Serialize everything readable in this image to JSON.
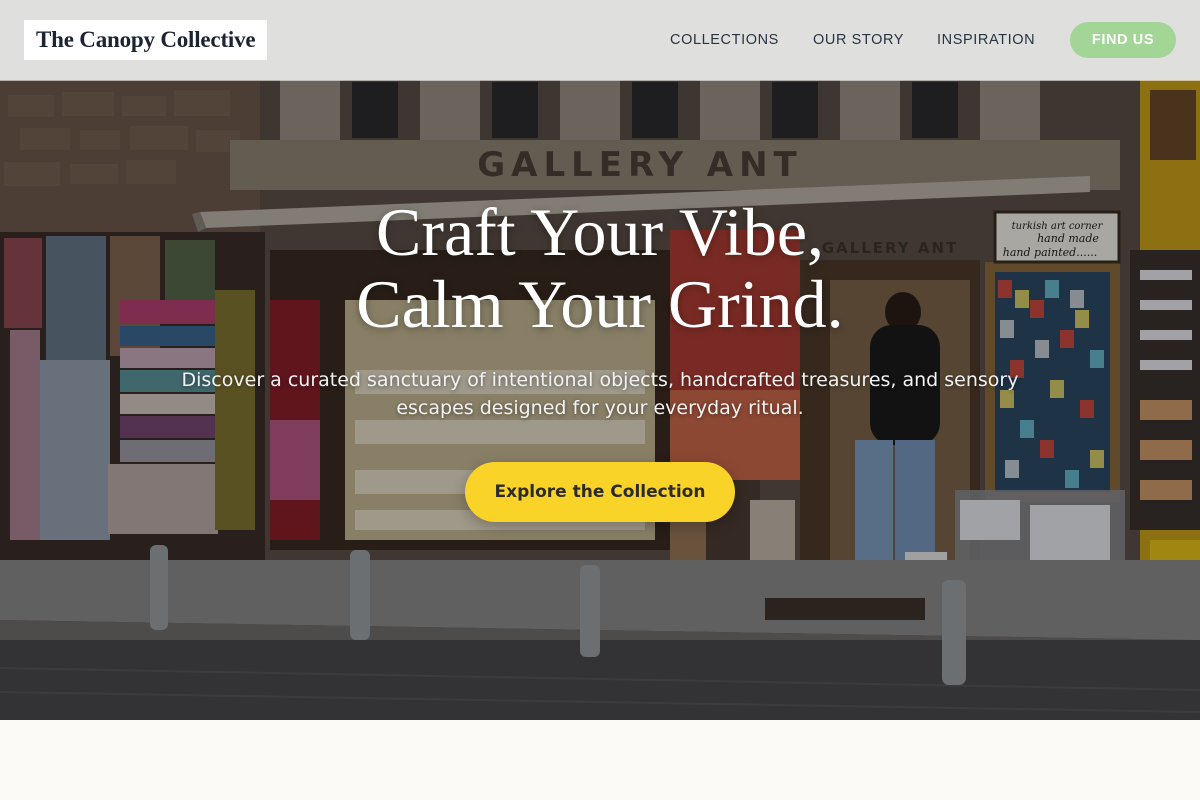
{
  "header": {
    "logo": "The Canopy Collective",
    "nav": {
      "collections": "COLLECTIONS",
      "our_story": "OUR STORY",
      "inspiration": "INSPIRATION"
    },
    "find_us": "FIND US"
  },
  "hero": {
    "headline_line1": "Craft Your Vibe,",
    "headline_line2": "Calm Your Grind.",
    "subtext": "Discover a curated sanctuary of intentional objects, handcrafted treasures, and sensory escapes designed for your everyday ritual.",
    "cta": "Explore the Collection",
    "photo": {
      "shop_sign": "GALLERY ANT",
      "inner_sign": "GALLERY ANT",
      "side_sign_line1": "turkish art corner",
      "side_sign_line2": "hand made",
      "side_sign_line3": "hand painted......"
    }
  },
  "colors": {
    "header_bg": "#ececec",
    "find_us_bg": "#a3d597",
    "cta_bg": "#f9d328",
    "page_bg": "#fbfaf6"
  }
}
